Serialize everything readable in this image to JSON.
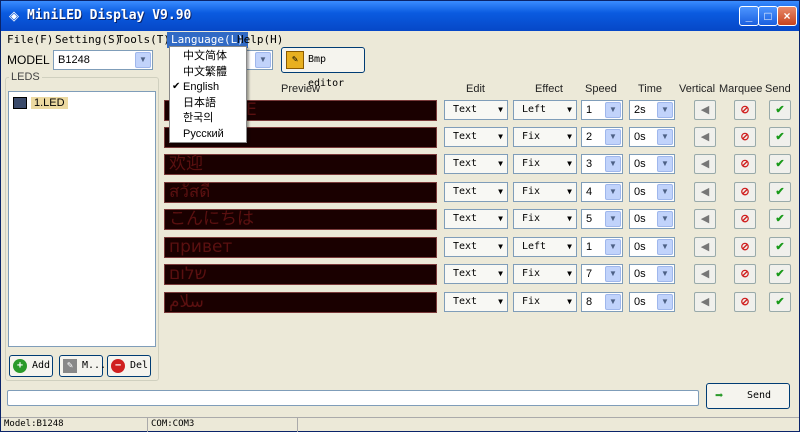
{
  "window": {
    "title": "MiniLED Display V9.90",
    "min": "_",
    "max": "□",
    "close": "×",
    "app_icon": "◈"
  },
  "menus": [
    "File(F)",
    "Setting(S)",
    "Tools(T)",
    "Language(L)",
    "Help(H)"
  ],
  "model": {
    "label": "MODEL",
    "value": "B1248"
  },
  "second_combo_partial": "",
  "bmp_editor": {
    "label": "Bmp editor",
    "icon": "paint-brush-icon"
  },
  "leds": {
    "group_label": "LEDS",
    "items": [
      "1.LED"
    ]
  },
  "left_buttons": {
    "add": "Add",
    "modify": "M...",
    "del": "Del"
  },
  "headers": {
    "preview": "Preview",
    "edit": "Edit",
    "effect": "Effect",
    "speed": "Speed",
    "time": "Time",
    "vertical": "Vertical",
    "marquee": "Marquee",
    "send": "Send"
  },
  "rows": [
    {
      "preview": "WELCOME",
      "edit": "Text",
      "effect": "Left",
      "speed": "1",
      "time": "2s"
    },
    {
      "preview": "",
      "edit": "Text",
      "effect": "Fix",
      "speed": "2",
      "time": "0s"
    },
    {
      "preview": "欢迎",
      "edit": "Text",
      "effect": "Fix",
      "speed": "3",
      "time": "0s"
    },
    {
      "preview": "สวัสดี",
      "edit": "Text",
      "effect": "Fix",
      "speed": "4",
      "time": "0s"
    },
    {
      "preview": "こんにちは",
      "edit": "Text",
      "effect": "Fix",
      "speed": "5",
      "time": "0s"
    },
    {
      "preview": "привет",
      "edit": "Text",
      "effect": "Left",
      "speed": "1",
      "time": "0s"
    },
    {
      "preview": "שלום",
      "edit": "Text",
      "effect": "Fix",
      "speed": "7",
      "time": "0s"
    },
    {
      "preview": "سلام",
      "edit": "Text",
      "effect": "Fix",
      "speed": "8",
      "time": "0s"
    }
  ],
  "send_button": "Send",
  "status": {
    "model": "Model:B1248",
    "com": "COM:COM3"
  },
  "language_menu": {
    "items": [
      "中文简体",
      "中文繁體",
      "English",
      "日本語",
      "한국의",
      "Русский"
    ],
    "checked_index": 2
  }
}
